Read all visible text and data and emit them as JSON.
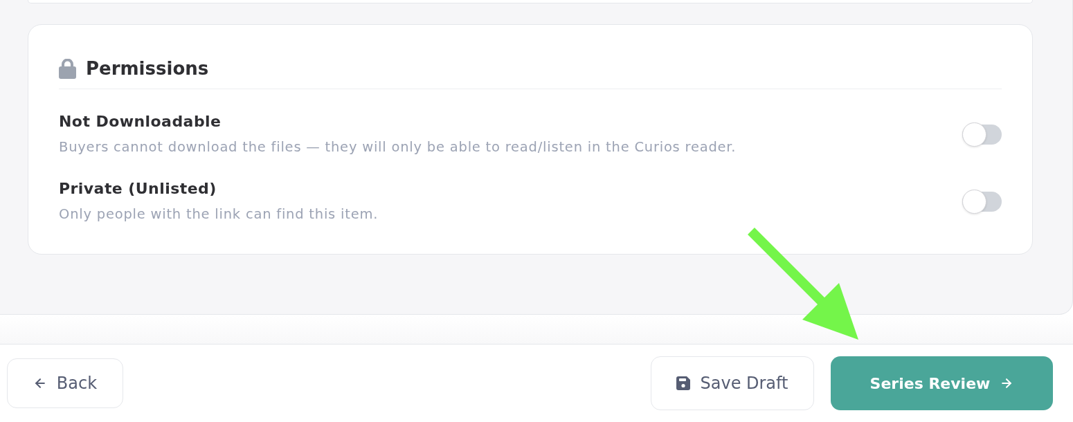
{
  "permissions": {
    "title": "Permissions",
    "items": [
      {
        "label": "Not Downloadable",
        "description": "Buyers cannot download the files — they will only be able to read/listen in the Curios reader.",
        "on": false
      },
      {
        "label": "Private (Unlisted)",
        "description": "Only people with the link can find this item.",
        "on": false
      }
    ]
  },
  "footer": {
    "buttons": [
      {
        "kind": "back",
        "label": "Back"
      },
      {
        "kind": "draft",
        "label": "Save Draft"
      },
      {
        "kind": "primary",
        "label": "Series Review"
      }
    ]
  }
}
